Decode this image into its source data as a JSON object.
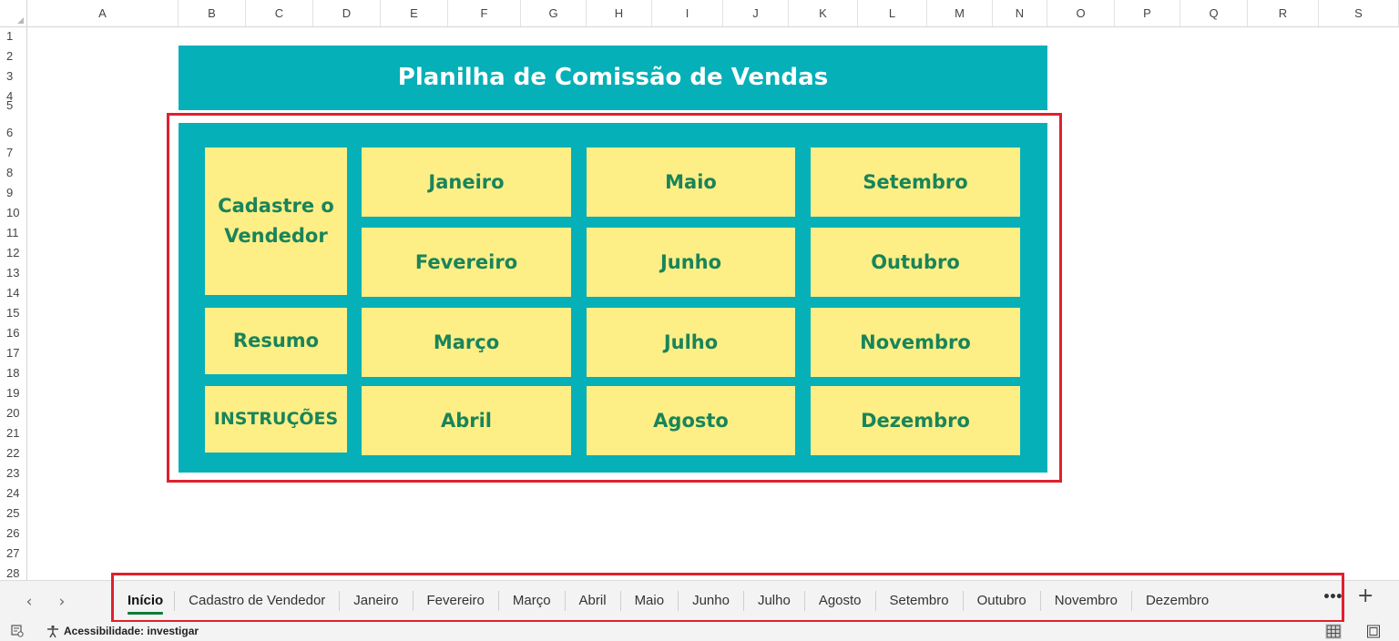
{
  "columns": [
    "A",
    "B",
    "C",
    "D",
    "E",
    "F",
    "G",
    "H",
    "I",
    "J",
    "K",
    "L",
    "M",
    "N",
    "O",
    "P",
    "Q",
    "R",
    "S"
  ],
  "rows": [
    "1",
    "2",
    "3",
    "4",
    "5",
    "6",
    "7",
    "8",
    "9",
    "10",
    "11",
    "12",
    "13",
    "14",
    "15",
    "16",
    "17",
    "18",
    "19",
    "20",
    "21",
    "22",
    "23",
    "24",
    "25",
    "26",
    "27",
    "28"
  ],
  "sheet": {
    "title": "Planilha de Comissão de Vendas",
    "buttons": {
      "cadastre": "Cadastre o Vendedor",
      "resumo": "Resumo",
      "instrucoes": "INSTRUÇÕES",
      "janeiro": "Janeiro",
      "fevereiro": "Fevereiro",
      "marco": "Março",
      "abril": "Abril",
      "maio": "Maio",
      "junho": "Junho",
      "julho": "Julho",
      "agosto": "Agosto",
      "setembro": "Setembro",
      "outubro": "Outubro",
      "novembro": "Novembro",
      "dezembro": "Dezembro"
    }
  },
  "tab_bar": {
    "nav_prev": "‹",
    "nav_next": "›",
    "tabs": [
      "Início",
      "Cadastro de Vendedor",
      "Janeiro",
      "Fevereiro",
      "Março",
      "Abril",
      "Maio",
      "Junho",
      "Julho",
      "Agosto",
      "Setembro",
      "Outubro",
      "Novembro",
      "Dezembro"
    ],
    "active_tab": "Início",
    "more": "•••",
    "add": "+"
  },
  "status_bar": {
    "accessibility": "Acessibilidade: investigar"
  },
  "colors": {
    "teal": "#05b0b8",
    "tile_yellow": "#fdee86",
    "tile_text_green": "#19845a",
    "highlight_red": "#e0202e",
    "active_tab_underline": "#0e7c3a"
  }
}
